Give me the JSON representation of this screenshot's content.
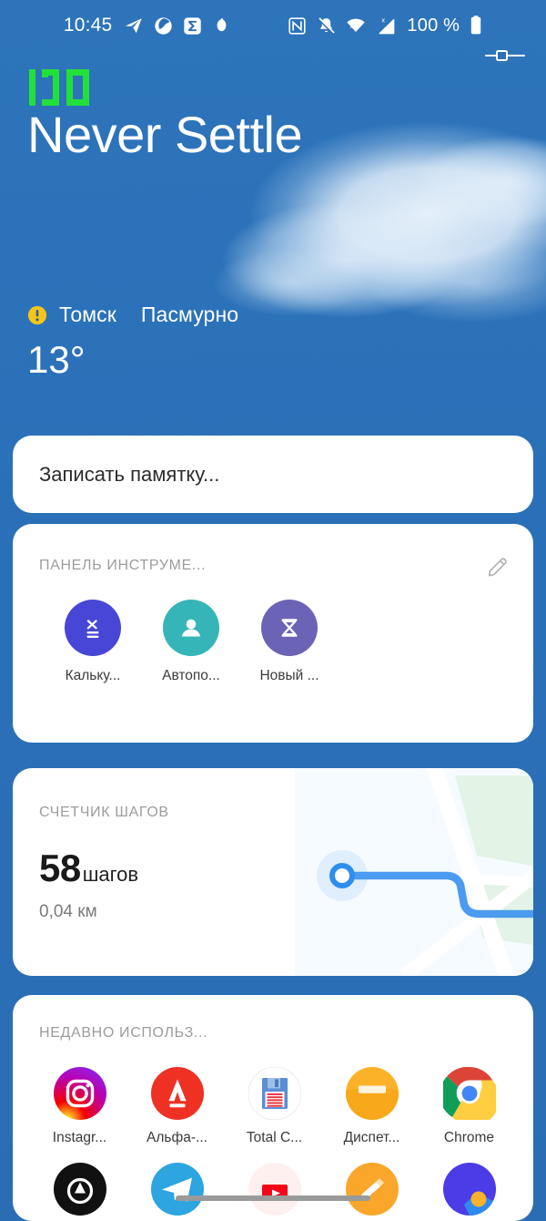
{
  "status_bar": {
    "time": "10:45",
    "battery_percent": "100 %",
    "icons": [
      "telegram-icon",
      "globe-app-icon",
      "sigma-app-icon",
      "drop-app-icon",
      "nfc-icon",
      "notifications-muted-icon",
      "wifi-icon",
      "cellular-no-sim-icon",
      "battery-icon"
    ],
    "brightness_slider": "brightness-slider-icon"
  },
  "hero": {
    "refresh_rate_badge": "120",
    "title": "Never Settle",
    "badge_color": "#22e03a"
  },
  "weather": {
    "warning_icon": "warning-icon",
    "warning_color": "#f5c518",
    "city": "Томск",
    "condition": "Пасмурно",
    "temperature": "13°"
  },
  "note_card": {
    "placeholder": "Записать памятку..."
  },
  "toolbar_card": {
    "title": "ПАНЕЛЬ ИНСТРУМЕ...",
    "edit_icon": "pencil-icon",
    "items": [
      {
        "label": "Кальку...",
        "icon": "calculator-icon",
        "color": "#4746d6"
      },
      {
        "label": "Автопо...",
        "icon": "person-icon",
        "color": "#36b5b8"
      },
      {
        "label": "Новый ...",
        "icon": "hourglass-icon",
        "color": "#6b63b5"
      }
    ]
  },
  "steps_card": {
    "title": "СЧЕТЧИК ШАГОВ",
    "count": "58",
    "unit": "шагов",
    "distance": "0,04 км",
    "map_route_color": "#4b9bf0"
  },
  "recent_card": {
    "title": "НЕДАВНО ИСПОЛЬЗ...",
    "row1": [
      {
        "label": "Instagr...",
        "icon": "instagram-icon"
      },
      {
        "label": "Альфа-...",
        "icon": "alfabank-icon"
      },
      {
        "label": "Total C...",
        "icon": "totalcommander-icon"
      },
      {
        "label": "Диспет...",
        "icon": "filemanager-icon"
      },
      {
        "label": "Chrome",
        "icon": "chrome-icon"
      }
    ],
    "row2": [
      {
        "label": "",
        "icon": "black-app-icon"
      },
      {
        "label": "",
        "icon": "telegram-app-icon"
      },
      {
        "label": "",
        "icon": "youtube-app-icon"
      },
      {
        "label": "",
        "icon": "orange-app-icon"
      },
      {
        "label": "",
        "icon": "blue-purple-app-icon"
      }
    ]
  },
  "nav": {
    "handle": "home-gesture-handle"
  },
  "theme": {
    "wallpaper_blue": "#2a70b8",
    "card_white": "#ffffff"
  }
}
